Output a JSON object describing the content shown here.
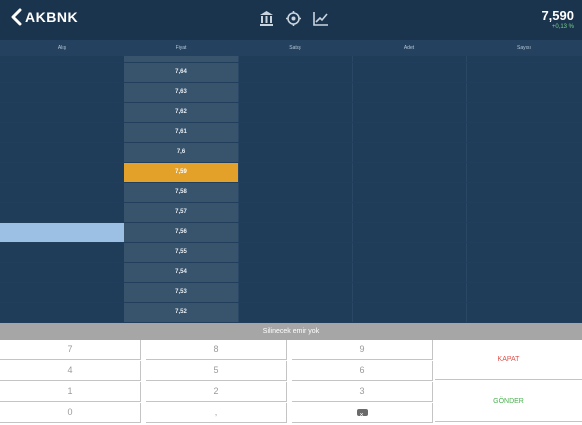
{
  "header": {
    "back_label": "AKBNK",
    "last_price": "7,590",
    "change": "+0,13 %",
    "tools": [
      "bank-icon",
      "settings-gear-icon",
      "line-chart-icon"
    ]
  },
  "columns": [
    "Alış",
    "Fiyat",
    "Satış",
    "Adet",
    "Sayısı"
  ],
  "depth": {
    "prices": [
      "7,64",
      "7,63",
      "7,62",
      "7,61",
      "7,6",
      "7,59",
      "7,58",
      "7,57",
      "7,56",
      "7,55",
      "7,54",
      "7,53",
      "7,52"
    ],
    "active_price": "7,59",
    "highlight_bid_row": 8
  },
  "status": "Silinecek emir yok",
  "keypad": {
    "keys": [
      "7",
      "8",
      "9",
      "4",
      "5",
      "6",
      "1",
      "2",
      "3",
      "0",
      ",",
      "⌫"
    ],
    "close_label": "KAPAT",
    "send_label": "GÖNDER"
  },
  "colors": {
    "header_bg": "#1b344e",
    "table_bg": "#1f3c58",
    "price_col_bg": "#38536c",
    "active_price_bg": "#e3a12a",
    "highlight_bid_bg": "#9cc0e3",
    "status_bg": "#a6a6a6",
    "close_color": "#e0504a",
    "send_color": "#4caf50"
  }
}
